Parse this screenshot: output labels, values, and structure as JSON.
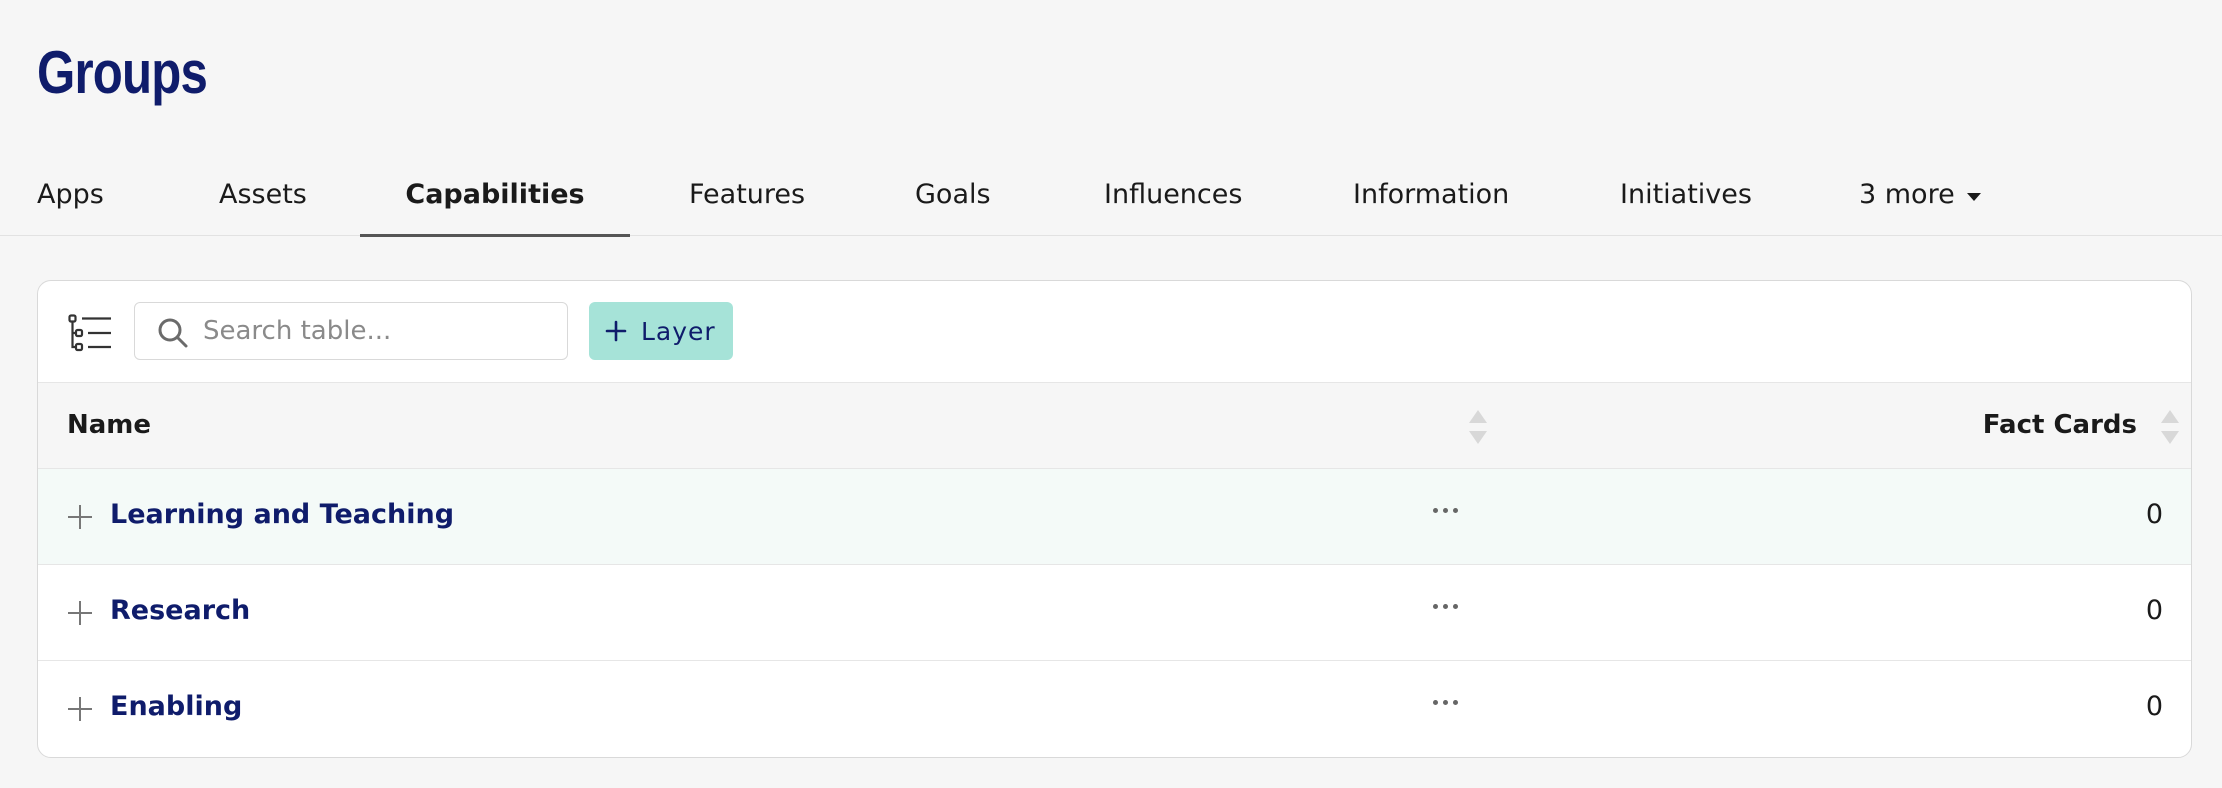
{
  "page": {
    "title": "Groups"
  },
  "tabs": [
    {
      "label": "Apps",
      "active": false
    },
    {
      "label": "Assets",
      "active": false
    },
    {
      "label": "Capabilities",
      "active": true
    },
    {
      "label": "Features",
      "active": false
    },
    {
      "label": "Goals",
      "active": false
    },
    {
      "label": "Influences",
      "active": false
    },
    {
      "label": "Information",
      "active": false
    },
    {
      "label": "Initiatives",
      "active": false
    },
    {
      "label": "3 more",
      "active": false,
      "icon": "caret-down-icon"
    }
  ],
  "toolbar": {
    "tree_icon": "tree-list-icon",
    "search": {
      "placeholder": "Search table...",
      "value": "",
      "icon": "search-icon"
    },
    "layer_button": {
      "label": "Layer",
      "icon": "plus-icon"
    }
  },
  "table": {
    "columns": {
      "name": "Name",
      "fact_cards": "Fact Cards"
    },
    "rows": [
      {
        "name": "Learning and Teaching",
        "fact_cards": "0",
        "highlighted": true
      },
      {
        "name": "Research",
        "fact_cards": "0",
        "highlighted": false
      },
      {
        "name": "Enabling",
        "fact_cards": "0",
        "highlighted": false
      }
    ]
  },
  "colors": {
    "title": "#0f1c6b",
    "link": "#0f1c6b",
    "accent_button": "#a6e3d8",
    "page_bg": "#f6f6f6"
  }
}
